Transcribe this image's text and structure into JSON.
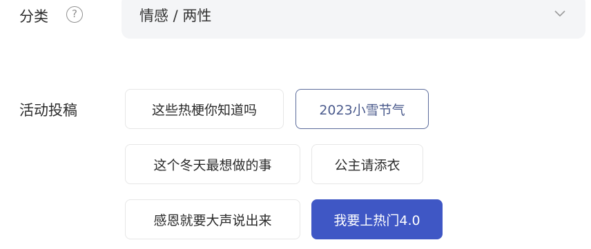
{
  "category": {
    "label": "分类",
    "help_icon_glyph": "?",
    "select_value": "情感 / 两性"
  },
  "activity": {
    "label": "活动投稿",
    "tags": [
      {
        "label": "这些热梗你知道吗",
        "state": "default"
      },
      {
        "label": "2023小雪节气",
        "state": "outlined"
      },
      {
        "label": "这个冬天最想做的事",
        "state": "default"
      },
      {
        "label": "公主请添衣",
        "state": "default"
      },
      {
        "label": "感恩就要大声说出来",
        "state": "default"
      },
      {
        "label": "我要上热门4.0",
        "state": "selected"
      }
    ]
  },
  "colors": {
    "accent": "#3f57c5",
    "outline": "#5a6a9a",
    "select_bg": "#f4f5f7"
  }
}
